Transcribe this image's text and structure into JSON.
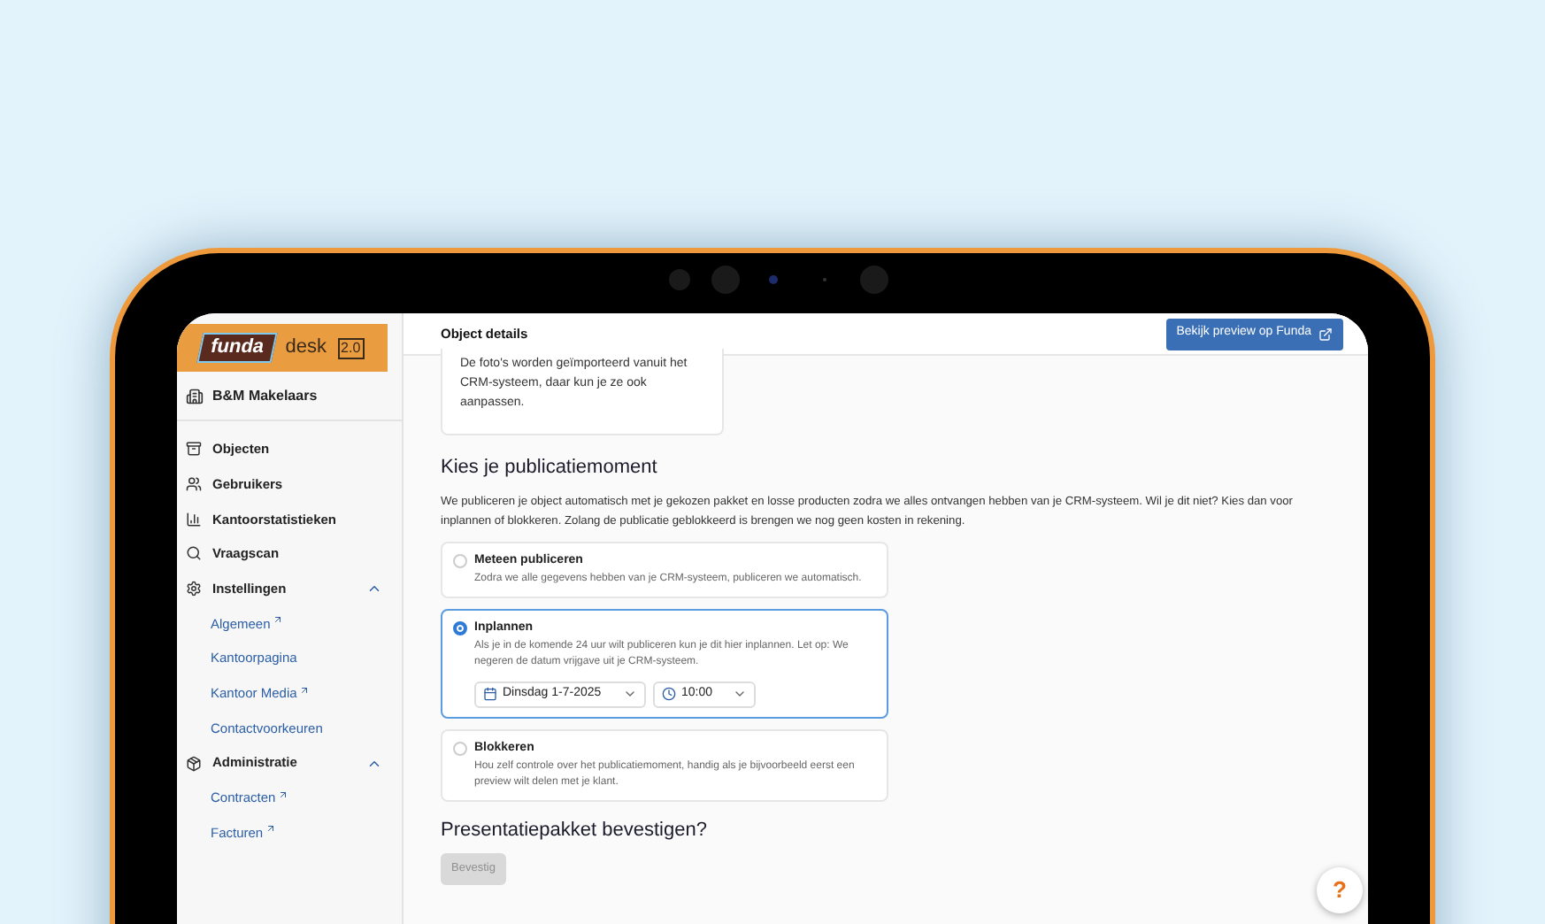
{
  "logo": {
    "brand": "funda",
    "product": "desk",
    "version": "2.0"
  },
  "sidebar": {
    "company": "B&M Makelaars",
    "items": [
      {
        "label": "Objecten"
      },
      {
        "label": "Gebruikers"
      },
      {
        "label": "Kantoorstatistieken"
      },
      {
        "label": "Vraagscan"
      },
      {
        "label": "Instellingen",
        "expanded": true,
        "children": [
          {
            "label": "Algemeen",
            "external": true
          },
          {
            "label": "Kantoorpagina",
            "external": false
          },
          {
            "label": "Kantoor Media",
            "external": true
          },
          {
            "label": "Contactvoorkeuren",
            "external": false
          }
        ]
      },
      {
        "label": "Administratie",
        "expanded": true,
        "children": [
          {
            "label": "Contracten",
            "external": true
          },
          {
            "label": "Facturen",
            "external": true
          }
        ]
      }
    ]
  },
  "header": {
    "title": "Object details",
    "preview_button": "Bekijk preview op Funda"
  },
  "photo_note": "De foto's worden geïmporteerd vanuit het CRM-systeem, daar kun je ze ook aanpassen.",
  "publish": {
    "heading": "Kies je publicatiemoment",
    "intro": "We publiceren je object automatisch met je gekozen pakket en losse producten zodra we alles ontvangen hebben van je CRM-systeem. Wil je dit niet? Kies dan voor inplannen of blokkeren. Zolang de publicatie geblokkeerd is brengen we nog geen kosten in rekening.",
    "options": [
      {
        "title": "Meteen publiceren",
        "description": "Zodra we alle gegevens hebben van je CRM-systeem, publiceren we automatisch.",
        "selected": false
      },
      {
        "title": "Inplannen",
        "description": "Als je in de komende 24 uur wilt publiceren kun je dit hier inplannen. Let op: We negeren de datum vrijgave uit je CRM-systeem.",
        "selected": true,
        "date": "Dinsdag 1-7-2025",
        "time": "10:00"
      },
      {
        "title": "Blokkeren",
        "description": "Hou zelf controle over het publicatiemoment, handig als je bijvoorbeeld eerst een preview wilt delen met je klant.",
        "selected": false
      }
    ]
  },
  "confirm": {
    "heading": "Presentatiepakket bevestigen?",
    "button": "Bevestig",
    "disabled": true
  },
  "help": "?"
}
